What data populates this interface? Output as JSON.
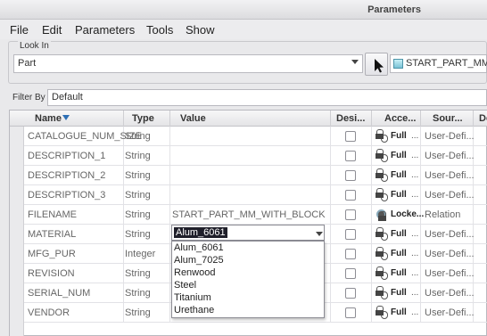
{
  "window": {
    "title": "Parameters"
  },
  "menu": [
    "File",
    "Edit",
    "Parameters",
    "Tools",
    "Show"
  ],
  "look_in": {
    "label": "Look In",
    "value": "Part",
    "path": "START_PART_MM_W"
  },
  "filter": {
    "label": "Filter By",
    "value": "Default"
  },
  "columns": [
    "Name",
    "Type",
    "Value",
    "Desi...",
    "Acce...",
    "Sour...",
    "De"
  ],
  "rows": [
    {
      "name": "CATALOGUE_NUM_SIZE",
      "type": "String",
      "value": "",
      "access": "Full",
      "source": "User-Defi..."
    },
    {
      "name": "DESCRIPTION_1",
      "type": "String",
      "value": "",
      "access": "Full",
      "source": "User-Defi..."
    },
    {
      "name": "DESCRIPTION_2",
      "type": "String",
      "value": "",
      "access": "Full",
      "source": "User-Defi..."
    },
    {
      "name": "DESCRIPTION_3",
      "type": "String",
      "value": "",
      "access": "Full",
      "source": "User-Defi..."
    },
    {
      "name": "FILENAME",
      "type": "String",
      "value": "START_PART_MM_WITH_BLOCK",
      "access": "Locke...",
      "source": "Relation"
    },
    {
      "name": "MATERIAL",
      "type": "String",
      "value": "",
      "access": "Full",
      "source": "User-Defi..."
    },
    {
      "name": "MFG_PUR",
      "type": "Integer",
      "value": "",
      "access": "Full",
      "source": "User-Defi..."
    },
    {
      "name": "REVISION",
      "type": "String",
      "value": "",
      "access": "Full",
      "source": "User-Defi..."
    },
    {
      "name": "SERIAL_NUM",
      "type": "String",
      "value": "",
      "access": "Full",
      "source": "User-Defi..."
    },
    {
      "name": "VENDOR",
      "type": "String",
      "value": "",
      "access": "Full",
      "source": "User-Defi..."
    }
  ],
  "ellipsis": "...",
  "material_editor": {
    "selected": "Alum_6061",
    "options": [
      "Alum_6061",
      "Alum_7025",
      "Renwood",
      "Steel",
      "Titanium",
      "Urethane"
    ]
  },
  "icons": {
    "sort": "sort-down-icon",
    "pick": "cursor-icon",
    "lock": "lock-icon",
    "locked": "locked-status-icon"
  }
}
